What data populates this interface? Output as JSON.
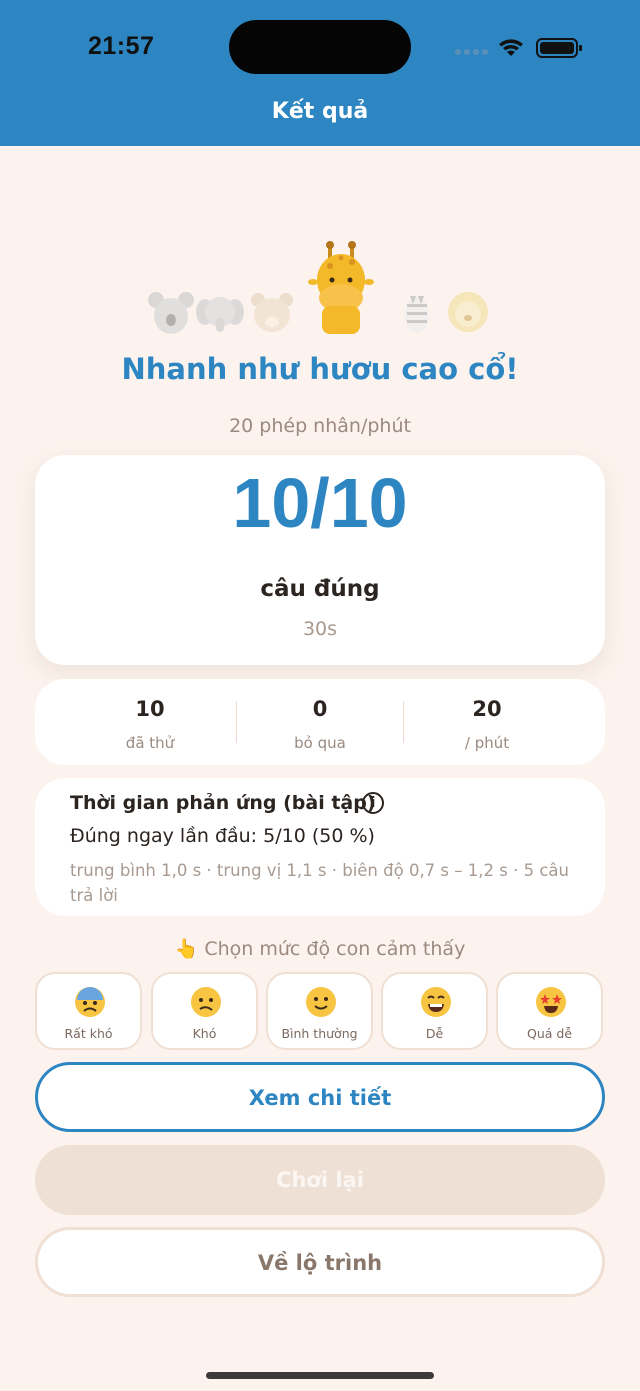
{
  "status": {
    "time": "21:57"
  },
  "nav": {
    "title": "Kết quả"
  },
  "result": {
    "headline": "Nhanh như hươu cao cổ!",
    "rate_text": "20 phép nhân/phút",
    "score": "10/10",
    "score_label": "câu đúng",
    "duration": "30s"
  },
  "stats": [
    {
      "value": "10",
      "label": "đã thử"
    },
    {
      "value": "0",
      "label": "bỏ qua"
    },
    {
      "value": "20",
      "label": "/ phút"
    }
  ],
  "reaction": {
    "title": "Thời gian phản ứng (bài tập)",
    "info_icon": "i",
    "first_try": "Đúng ngay lần đầu: 5/10 (50 %)",
    "details": "trung bình 1,0 s · trung vị 1,1 s · biên độ 0,7 s – 1,2 s · 5 câu trả lời"
  },
  "feeling": {
    "prompt": "👆 Chọn mức độ con cảm thấy",
    "options": [
      {
        "label": "Rất khó",
        "icon": "anxious-sweat-face-icon"
      },
      {
        "label": "Khó",
        "icon": "confused-face-icon"
      },
      {
        "label": "Bình thường",
        "icon": "slight-smile-face-icon"
      },
      {
        "label": "Dễ",
        "icon": "grinning-face-icon"
      },
      {
        "label": "Quá dễ",
        "icon": "star-struck-face-icon"
      }
    ]
  },
  "actions": {
    "detail": "Xem chi tiết",
    "replay": "Chơi lại",
    "route": "Về lộ trình"
  },
  "colors": {
    "accent": "#2d86c2",
    "background": "#fcf3ee",
    "card": "#ffffff",
    "muted_text": "#9a8a80"
  },
  "animals": [
    "koala-icon",
    "elephant-icon",
    "bear-icon",
    "giraffe-icon",
    "zebra-icon",
    "lion-icon"
  ]
}
